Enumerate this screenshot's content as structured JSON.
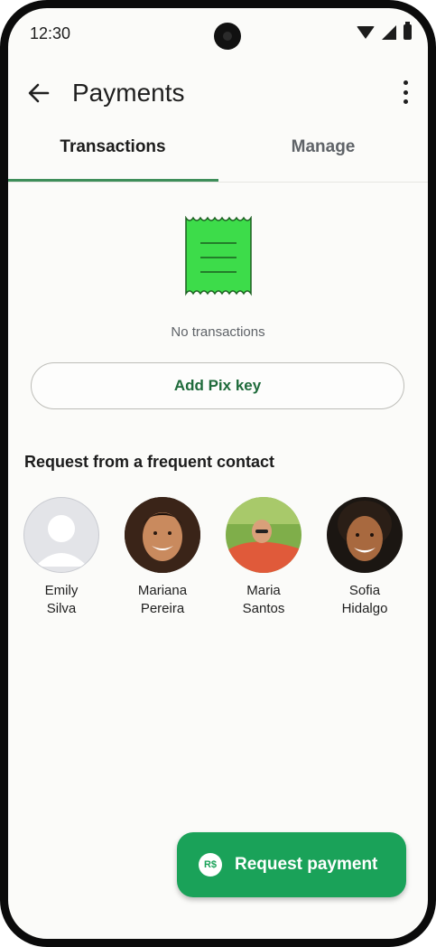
{
  "status_bar": {
    "time": "12:30"
  },
  "app_bar": {
    "title": "Payments"
  },
  "tabs": [
    {
      "label": "Transactions",
      "selected": true
    },
    {
      "label": "Manage",
      "selected": false
    }
  ],
  "empty_state": {
    "message": "No transactions",
    "icon": "receipt-icon"
  },
  "add_pix_button": {
    "label": "Add Pix key"
  },
  "frequent_contacts": {
    "heading": "Request from a frequent contact",
    "contacts": [
      {
        "first": "Emily",
        "last": "Silva",
        "avatar": "placeholder"
      },
      {
        "first": "Mariana",
        "last": "Pereira",
        "avatar": "photo"
      },
      {
        "first": "Maria",
        "last": "Santos",
        "avatar": "photo"
      },
      {
        "first": "Sofia",
        "last": "Hidalgo",
        "avatar": "photo"
      }
    ]
  },
  "fab": {
    "label": "Request payment",
    "icon_text": "R$"
  },
  "colors": {
    "accent": "#1aa259",
    "tab_indicator": "#3e8e5a",
    "link_text": "#1f6b3b",
    "receipt": "#3ddc4a"
  }
}
